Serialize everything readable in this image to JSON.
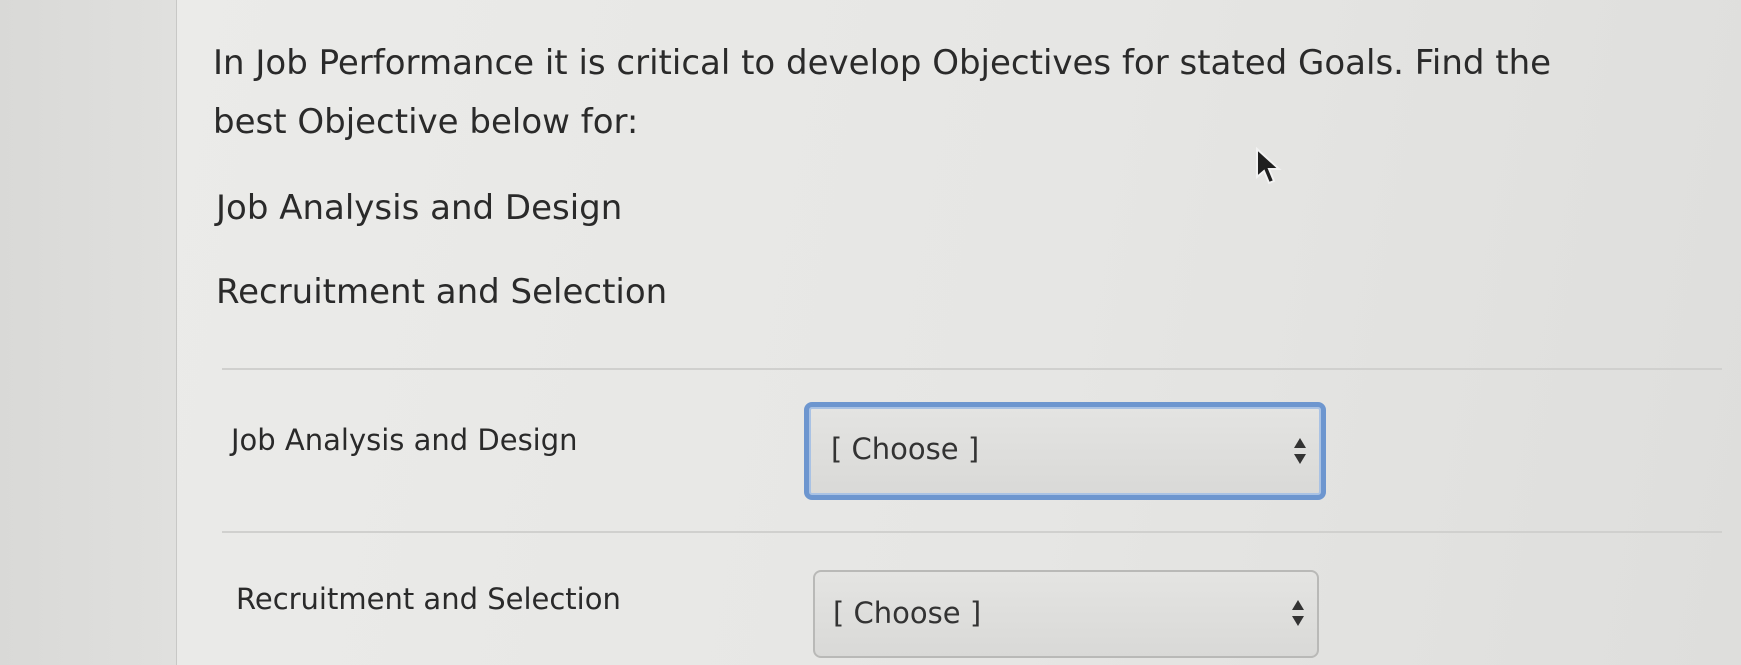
{
  "question": {
    "text": "In Job Performance it is critical to develop Objectives for stated Goals.  Find the best Objective below for:"
  },
  "items": [
    "Job Analysis and Design",
    "Recruitment and Selection"
  ],
  "rows": [
    {
      "label": "Job Analysis and Design",
      "select_value": "[ Choose ]",
      "focused": true
    },
    {
      "label": "Recruitment and Selection",
      "select_value": "[ Choose ]",
      "focused": false
    }
  ],
  "colors": {
    "focus_border": "#6d96cf",
    "background": "#e6e6e4",
    "text": "#2a2a2a"
  },
  "icons": {
    "select_arrows": "up-down-arrows-icon",
    "cursor": "mouse-pointer-icon"
  }
}
